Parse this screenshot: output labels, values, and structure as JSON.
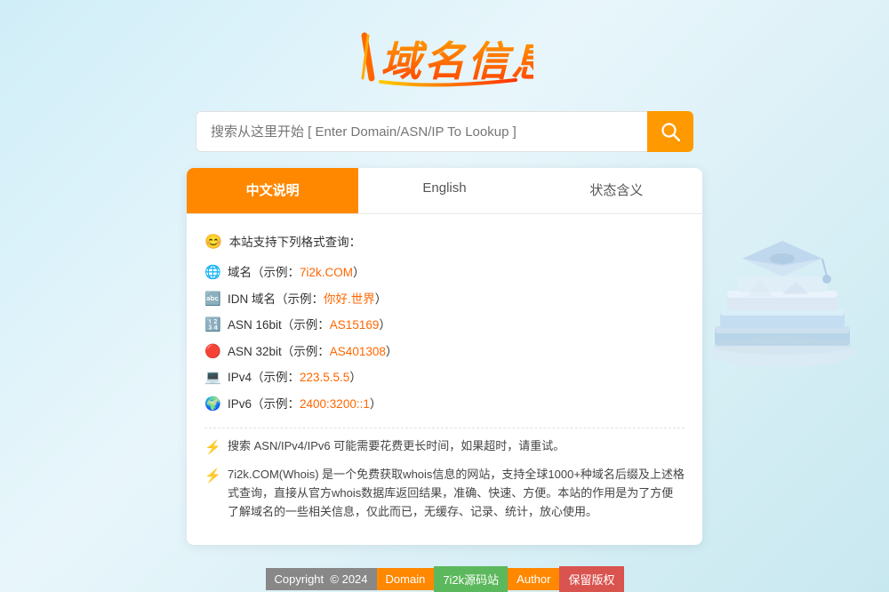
{
  "logo": {
    "text": "域名信息"
  },
  "search": {
    "placeholder": "搜索从这里开始 [ Enter Domain/ASN/IP To Lookup ]",
    "button_icon": "🔍"
  },
  "tabs": [
    {
      "id": "chinese",
      "label": "中文说明",
      "active": true
    },
    {
      "id": "english",
      "label": "English",
      "active": false
    },
    {
      "id": "status",
      "label": "状态含义",
      "active": false
    }
  ],
  "content": {
    "intro_title": "本站支持下列格式查询：",
    "items": [
      {
        "icon": "🌐",
        "text": "域名（示例：",
        "link": "7i2k.COM",
        "after": "）"
      },
      {
        "icon": "🔤",
        "text": "IDN 域名（示例：",
        "link": "你好.世界",
        "after": "）"
      },
      {
        "icon": "🔢",
        "text": "ASN 16bit（示例：",
        "link": "AS15169",
        "after": "）"
      },
      {
        "icon": "🔴",
        "text": "ASN 32bit（示例：",
        "link": "AS401308",
        "after": "）"
      },
      {
        "icon": "💻",
        "text": "IPv4（示例：",
        "link": "223.5.5.5",
        "after": "）"
      },
      {
        "icon": "🌍",
        "text": "IPv6（示例：",
        "link": "2400:3200::1",
        "after": "）"
      }
    ],
    "notices": [
      {
        "icon": "⚡",
        "text": "搜索 ASN/IPv4/IPv6 可能需要花费更长时间，如果超时，请重试。"
      },
      {
        "icon": "⚡",
        "text": "7i2k.COM(Whois) 是一个免费获取whois信息的网站，支持全球1000+种域名后缀及上述格式查询，直接从官方whois数据库返回结果，准确、快速、方便。本站的作用是为了方便了解域名的一些相关信息，仅此而已，无缓存、记录、统计，放心使用。"
      }
    ]
  },
  "footer": {
    "copyright_label": "Copyright",
    "copyright_symbol": "©",
    "year": "2024",
    "domain_label": "Domain",
    "domain_value": "7i2k源码站",
    "author_label": "Author",
    "author_value": "保留版权"
  }
}
